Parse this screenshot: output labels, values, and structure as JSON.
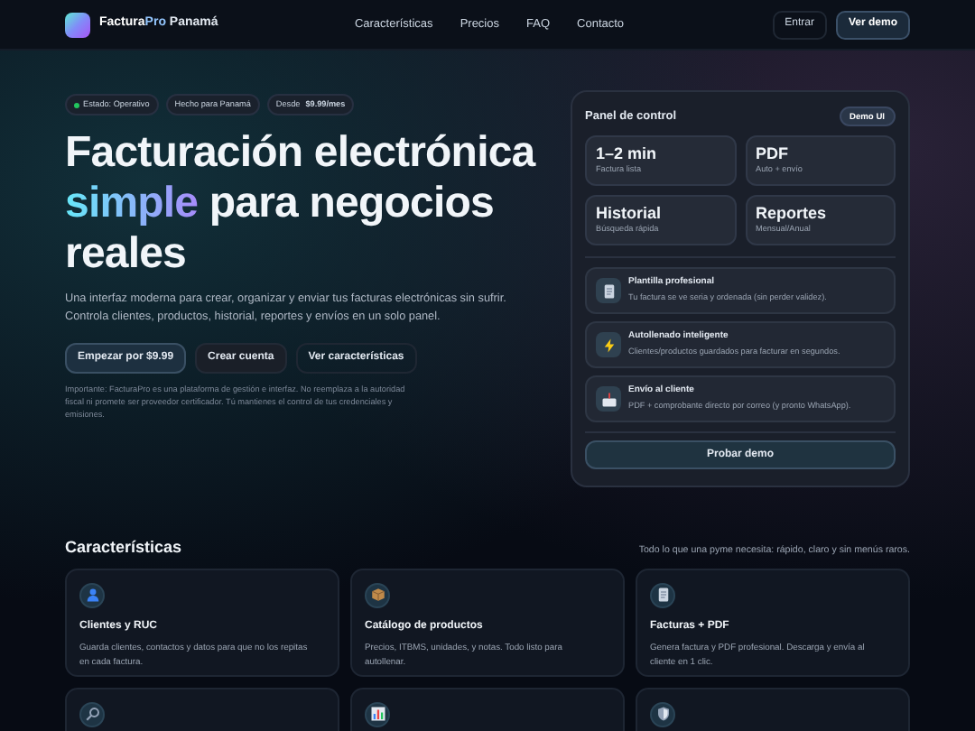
{
  "brand": {
    "name_a": "Factura",
    "name_b": "Pro",
    "name_c": " Panamá"
  },
  "nav": [
    "Características",
    "Precios",
    "FAQ",
    "Contacto"
  ],
  "nav_buttons": [
    {
      "label": "Entrar",
      "kind": "ghost"
    },
    {
      "label": "Ver demo",
      "kind": "primary"
    }
  ],
  "badges": [
    {
      "label": "Estado: Operativo",
      "color": "#22c55e"
    },
    {
      "label": "Hecho para Panamá"
    },
    {
      "label": "Desde",
      "value": "$9.99/mes"
    }
  ],
  "headline": {
    "line_a": "Facturación electrónica",
    "accent": "simple",
    "rest": " para negocios reales"
  },
  "lead": "Una interfaz moderna para crear, organizar y enviar tus facturas electrónicas sin sufrir. Controla clientes, productos, historial, reportes y envíos en un solo panel.",
  "cta": [
    {
      "label": "Empezar por $9.99",
      "kind": "primary"
    },
    {
      "label": "Crear cuenta",
      "kind": "dark"
    },
    {
      "label": "Ver características",
      "kind": "ghost"
    }
  ],
  "disclaimer": "Importante: FacturaPro es una plataforma de gestión e interfaz. No reemplaza a la autoridad fiscal ni promete ser proveedor certificador. Tú mantienes el control de tus credenciales y emisiones.",
  "panel": {
    "title": "Panel de control",
    "tag": "Demo UI",
    "stats": [
      {
        "value": "1–2 min",
        "label": "Factura lista"
      },
      {
        "value": "PDF",
        "label": "Auto + envío"
      },
      {
        "value": "Historial",
        "label": "Búsqueda rápida"
      },
      {
        "value": "Reportes",
        "label": "Mensual/Anual"
      }
    ],
    "items": [
      {
        "title": "Plantilla profesional",
        "text": "Tu factura se ve seria y ordenada (sin perder validez)."
      },
      {
        "title": "Autollenado inteligente",
        "text": "Clientes/productos guardados para facturar en segundos."
      },
      {
        "title": "Envío al cliente",
        "text": "PDF + comprobante directo por correo (y pronto WhatsApp)."
      }
    ],
    "button": "Probar demo"
  },
  "features": {
    "title": "Características",
    "subtitle": "Todo lo que una pyme necesita: rápido, claro y sin menús raros.",
    "cards": [
      {
        "kind": "full",
        "title": "Clientes y RUC",
        "text": "Guarda clientes, contactos y datos para que no los repitas en cada factura."
      },
      {
        "kind": "full",
        "title": "Catálogo de productos",
        "text": "Precios, ITBMS, unidades, y notas. Todo listo para autollenar."
      },
      {
        "kind": "full",
        "title": "Facturas + PDF",
        "text": "Genera factura y PDF profesional. Descarga y envía al cliente en 1 clic."
      },
      {
        "kind": "cut"
      },
      {
        "kind": "cut"
      },
      {
        "kind": "cut"
      }
    ]
  }
}
